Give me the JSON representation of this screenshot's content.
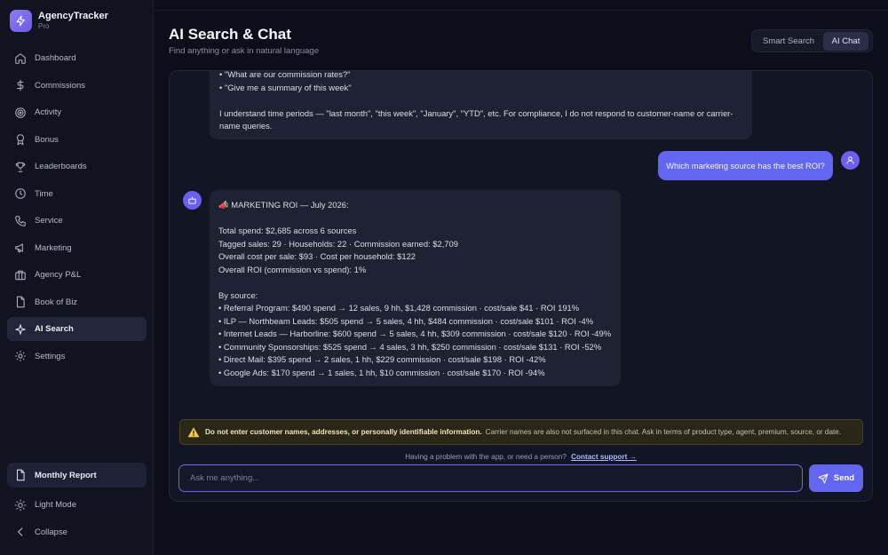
{
  "app": {
    "name": "AgencyTracker",
    "tier": "Pro"
  },
  "sidebar": {
    "items": [
      {
        "label": "Dashboard",
        "icon": "home-icon"
      },
      {
        "label": "Commissions",
        "icon": "dollar-icon"
      },
      {
        "label": "Activity",
        "icon": "target-icon"
      },
      {
        "label": "Bonus",
        "icon": "award-icon"
      },
      {
        "label": "Leaderboards",
        "icon": "trophy-icon"
      },
      {
        "label": "Time",
        "icon": "clock-icon"
      },
      {
        "label": "Service",
        "icon": "phone-icon"
      },
      {
        "label": "Marketing",
        "icon": "megaphone-icon"
      },
      {
        "label": "Agency P&L",
        "icon": "briefcase-icon"
      },
      {
        "label": "Book of Biz",
        "icon": "file-icon"
      },
      {
        "label": "AI Search",
        "icon": "sparkle-icon",
        "active": true
      },
      {
        "label": "Settings",
        "icon": "gear-icon"
      }
    ],
    "monthly_report": "Monthly Report",
    "light_mode": "Light Mode",
    "collapse": "Collapse"
  },
  "header": {
    "title": "AI Search & Chat",
    "subtitle": "Find anything or ask in natural language",
    "modes": {
      "smart": "Smart Search",
      "ai": "AI Chat",
      "active": "ai"
    }
  },
  "chat": {
    "messages": [
      {
        "role": "assistant",
        "text": "• \"What are our commission rates?\"\n• \"Give me a summary of this week\"\n\nI understand time periods — \"last month\", \"this week\", \"January\", \"YTD\", etc. For compliance, I do not respond to customer-name or carrier-name queries."
      },
      {
        "role": "user",
        "text": "Which marketing source has the best ROI?"
      },
      {
        "role": "assistant",
        "text": "📣 MARKETING ROI — July 2026:\n\nTotal spend: $2,685 across 6 sources\nTagged sales: 29 · Households: 22 · Commission earned: $2,709\nOverall cost per sale: $93 · Cost per household: $122\nOverall ROI (commission vs spend): 1%\n\nBy source:\n• Referral Program: $490 spend → 12 sales, 9 hh, $1,428 commission · cost/sale $41 · ROI 191%\n• ILP — Northbeam Leads: $505 spend → 5 sales, 4 hh, $484 commission · cost/sale $101 · ROI -4%\n• Internet Leads — Harborline: $600 spend → 5 sales, 4 hh, $309 commission · cost/sale $120 · ROI -49%\n• Community Sponsorships: $525 spend → 4 sales, 3 hh, $250 commission · cost/sale $131 · ROI -52%\n• Direct Mail: $395 spend → 2 sales, 1 hh, $229 commission · cost/sale $198 · ROI -42%\n• Google Ads: $170 spend → 1 sales, 1 hh, $10 commission · cost/sale $170 · ROI -94%"
      }
    ],
    "warning_bold": "Do not enter customer names, addresses, or personally identifiable information.",
    "warning_text": "Carrier names are also not surfaced in this chat. Ask in terms of product type, agent, premium, source, or date.",
    "support_text": "Having a problem with the app, or need a person?",
    "support_link": "Contact support →",
    "input_placeholder": "Ask me anything...",
    "input_value": "",
    "send_label": "Send"
  },
  "colors": {
    "accent": "#6366f1",
    "background": "#0c0e1a",
    "panel": "#121524",
    "warning": "#2a2618"
  }
}
